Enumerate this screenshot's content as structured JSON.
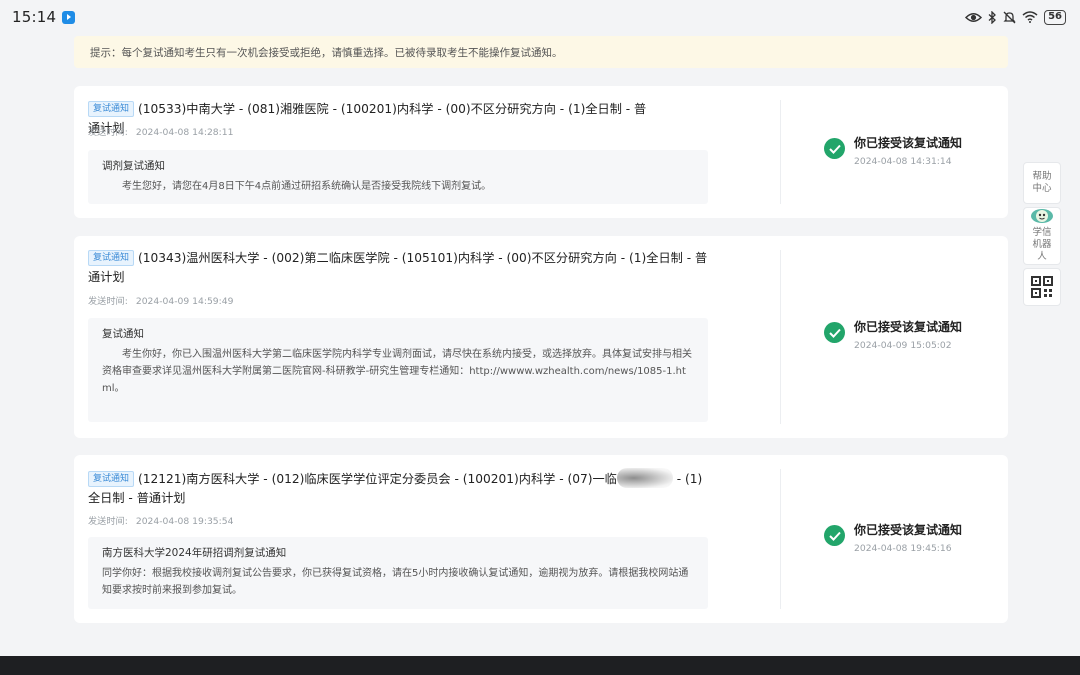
{
  "status_bar": {
    "time": "15:14",
    "battery": "56"
  },
  "tip": "提示：每个复试通知考生只有一次机会接受或拒绝，请慎重选择。已被待录取考生不能操作复试通知。",
  "sent_label": "发送时间:",
  "notices": [
    {
      "tag": "复试通知",
      "title": "(10533)中南大学 - (081)湘雅医院 - (100201)内科学 - (00)不区分研究方向 - (1)全日制 - 普通计划",
      "sent_time": "2024-04-08 14:28:11",
      "msg_title": "调剂复试通知",
      "msg_body": "考生您好，请您在4月8日下午4点前通过研招系统确认是否接受我院线下调剂复试。",
      "status": "你已接受该复试通知",
      "status_time": "2024-04-08 14:31:14"
    },
    {
      "tag": "复试通知",
      "title": "(10343)温州医科大学 - (002)第二临床医学院 - (105101)内科学 - (00)不区分研究方向 - (1)全日制 - 普通计划",
      "sent_time": "2024-04-09 14:59:49",
      "msg_title": "复试通知",
      "msg_body": "考生你好，你已入围温州医科大学第二临床医学院内科学专业调剂面试，请尽快在系统内接受，或选择放弃。具体复试安排与相关资格审查要求详见温州医科大学附属第二医院官网-科研教学-研究生管理专栏通知：http://wwww.wzhealth.com/news/1085-1.html。",
      "status": "你已接受该复试通知",
      "status_time": "2024-04-09 15:05:02"
    },
    {
      "tag": "复试通知",
      "title_part1": "(12121)南方医科大学 - (012)临床医学学位评定分委员会 - (100201)内科学 - (07)一临",
      "title_part2": " - (1)全日制 - 普通计划",
      "sent_time": "2024-04-08 19:35:54",
      "msg_title": "南方医科大学2024年研招调剂复试通知",
      "msg_body": "同学你好：根据我校接收调剂复试公告要求，你已获得复试资格，请在5小时内接收确认复试通知，逾期视为放弃。请根据我校网站通知要求按时前来报到参加复试。",
      "status": "你已接受该复试通知",
      "status_time": "2024-04-08 19:45:16"
    }
  ],
  "float_panel": {
    "help": "帮助中心",
    "robot": "学信机器人"
  }
}
